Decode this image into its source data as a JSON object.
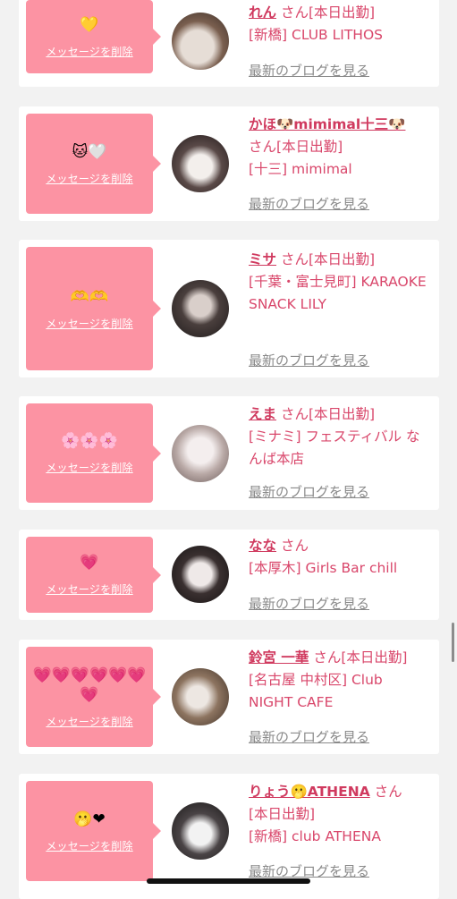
{
  "ui": {
    "delete_label": "メッセージを削除",
    "blog_label": "最新のブログを見る",
    "accent": "#fc93a3",
    "name_color": "#d03a5f"
  },
  "entries": [
    {
      "emoji": "💛",
      "name": "れん",
      "san": "さん",
      "work": "[本日出勤]",
      "shop": "[新橋] CLUB LITHOS"
    },
    {
      "emoji": "🐱🤍",
      "name": "かほ🐶mimimal十三🐶",
      "san": "さん",
      "work": "[本日出勤]",
      "shop": "[十三] mimimal"
    },
    {
      "emoji": "🫶🫶",
      "name": "ミサ",
      "san": "さん",
      "work": "[本日出勤]",
      "shop": "[千葉・富士見町] KARAOKE SNACK LILY"
    },
    {
      "emoji": "🌸🌸🌸",
      "name": "えま",
      "san": "さん",
      "work": "[本日出勤]",
      "shop": "[ミナミ] フェスティバル なんば本店"
    },
    {
      "emoji": "💗",
      "name": "なな",
      "san": "さん",
      "work": "",
      "shop": "[本厚木] Girls Bar chill"
    },
    {
      "emoji": "💗💗💗💗💗💗💗",
      "name": "鈴宮 一華",
      "san": "さん",
      "work": "[本日出勤]",
      "shop": "[名古屋 中村区] Club NIGHT CAFE"
    },
    {
      "emoji": "🫢❤",
      "name": "りょう🫢ATHENA",
      "san": "さん",
      "work": "[本日出勤]",
      "shop": "[新橋] club ATHENA"
    }
  ]
}
